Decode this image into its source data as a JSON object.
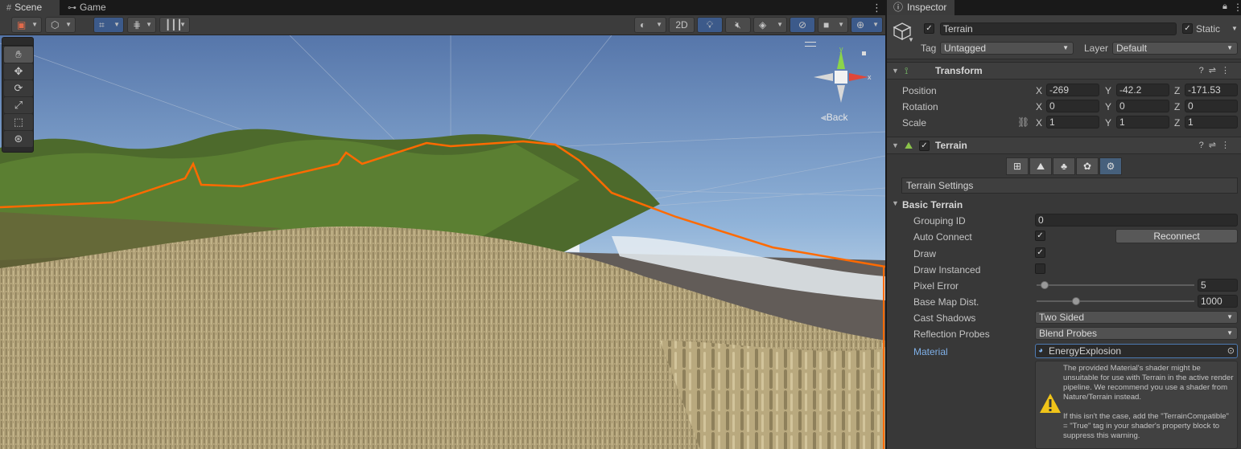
{
  "scene": {
    "tabs": [
      {
        "label": "Scene",
        "icon": "grid-icon"
      },
      {
        "label": "Game",
        "icon": "gamepad-icon"
      }
    ],
    "toolbar": {
      "twod_label": "2D"
    },
    "tools": [
      "hand",
      "move",
      "rotate",
      "scale",
      "rect",
      "transform"
    ],
    "gizmo": {
      "y_label": "y",
      "x_label": "x",
      "back_label": "Back"
    },
    "colors": {
      "selection_outline": "#ff6a00",
      "sky_top": "#5b7fb4",
      "ground": "#b5a47a"
    }
  },
  "inspector": {
    "tab_label": "Inspector",
    "object": {
      "active": true,
      "name": "Terrain",
      "static_label": "Static",
      "static": true,
      "tag_label": "Tag",
      "tag_value": "Untagged",
      "layer_label": "Layer",
      "layer_value": "Default"
    },
    "transform": {
      "title": "Transform",
      "rows": [
        {
          "label": "Position",
          "x": "-269",
          "y": "-42.2",
          "z": "-171.53"
        },
        {
          "label": "Rotation",
          "x": "0",
          "y": "0",
          "z": "0"
        },
        {
          "label": "Scale",
          "x": "1",
          "y": "1",
          "z": "1"
        }
      ],
      "axes": [
        "X",
        "Y",
        "Z"
      ]
    },
    "terrain": {
      "title": "Terrain",
      "enabled": true,
      "settings_label": "Terrain Settings",
      "section_label": "Basic Terrain",
      "grouping_id_label": "Grouping ID",
      "grouping_id": "0",
      "auto_connect_label": "Auto Connect",
      "auto_connect": true,
      "reconnect_label": "Reconnect",
      "draw_label": "Draw",
      "draw": true,
      "draw_instanced_label": "Draw Instanced",
      "draw_instanced": false,
      "pixel_error_label": "Pixel Error",
      "pixel_error": "5",
      "pixel_error_fraction": 0.05,
      "base_map_label": "Base Map Dist.",
      "base_map": "1000",
      "base_map_fraction": 0.25,
      "cast_shadows_label": "Cast Shadows",
      "cast_shadows": "Two Sided",
      "reflection_label": "Reflection Probes",
      "reflection": "Blend Probes",
      "material_label": "Material",
      "material": "EnergyExplosion",
      "help_p1": "The provided Material's shader might be unsuitable for use with Terrain in the active render pipeline. We recommend you use a shader from Nature/Terrain instead.",
      "help_p2": "If this isn't the case, add the \"TerrainCompatible\" = \"True\" tag in your shader's property block to suppress this warning."
    }
  }
}
